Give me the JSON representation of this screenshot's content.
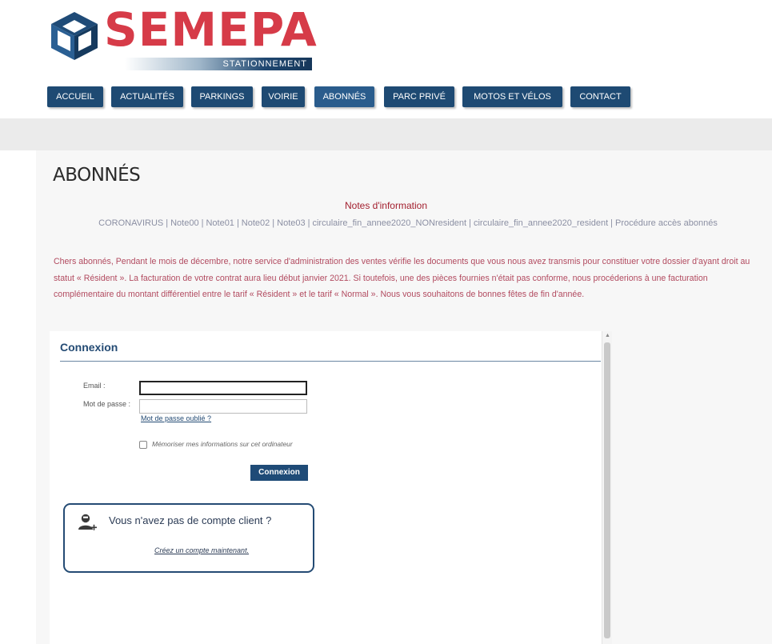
{
  "brand": {
    "name": "SEMEPA",
    "tagline": "STATIONNEMENT",
    "color": "#d63b48"
  },
  "nav": {
    "items": [
      {
        "label": "ACCUEIL"
      },
      {
        "label": "ACTUALITÉS"
      },
      {
        "label": "PARKINGS"
      },
      {
        "label": "VOIRIE"
      },
      {
        "label": "ABONNÉS"
      },
      {
        "label": "PARC PRIVÉ"
      },
      {
        "label": "MOTOS ET VÉLOS"
      },
      {
        "label": "CONTACT"
      }
    ],
    "active": "ABONNÉS",
    "color": "#1e4a73"
  },
  "page": {
    "title": "ABONNÉS"
  },
  "notes": {
    "title": "Notes d'information",
    "links": [
      "CORONAVIRUS",
      "Note00",
      "Note01",
      "Note02",
      "Note03",
      "circulaire_fin_annee2020_NONresident",
      "circulaire_fin_annee2020_resident",
      "Procédure accès abonnés"
    ],
    "separator": "|"
  },
  "message": {
    "text": "Chers abonnés, Pendant le mois de décembre, notre service d'administration des ventes vérifie les documents que vous nous avez transmis pour constituer votre dossier d'ayant droit au statut « Résident ». La facturation de votre contrat aura lieu début janvier 2021. Si toutefois, une des pièces fournies n'était pas conforme, nous procéderions à une facturation complémentaire du montant différentiel entre le tarif « Résident » et le tarif « Normal ». Nous vous souhaitons de bonnes fêtes de fin d'année."
  },
  "login": {
    "title": "Connexion",
    "email_label": "Email :",
    "email_value": "",
    "password_label": "Mot de passe :",
    "password_value": "",
    "forgot_label": "Mot de passe oublié ?",
    "remember_label": "Mémoriser mes informations sur cet ordinateur",
    "remember_checked": false,
    "submit_label": "Connexion"
  },
  "register": {
    "title": "Vous n'avez pas de compte client ?",
    "link_label": "Créez un compte maintenant.",
    "icon": "user-add-icon"
  }
}
